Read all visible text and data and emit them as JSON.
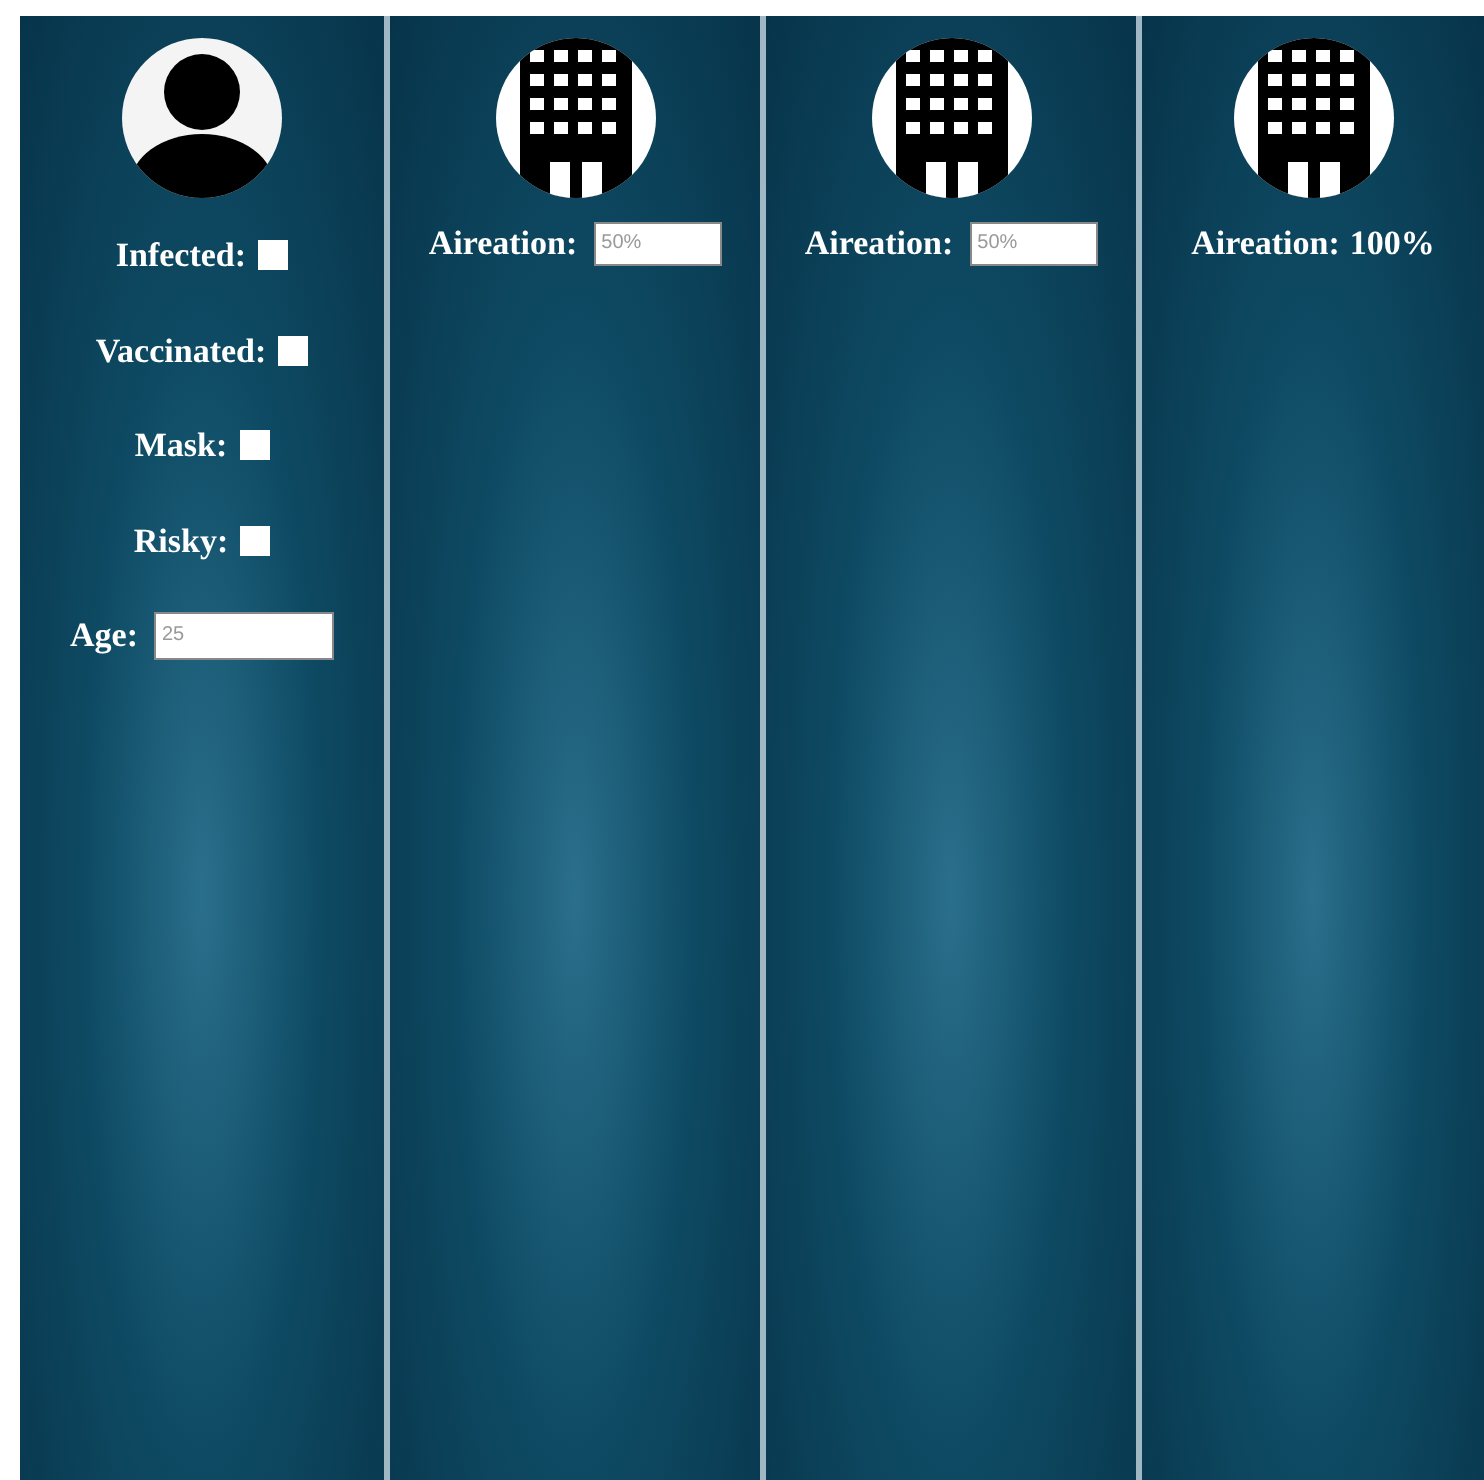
{
  "person": {
    "fields": [
      {
        "kind": "checkbox",
        "label": "Infected:",
        "checked": false
      },
      {
        "kind": "checkbox",
        "label": "Vaccinated:",
        "checked": false
      },
      {
        "kind": "checkbox",
        "label": "Mask:",
        "checked": false
      },
      {
        "kind": "checkbox",
        "label": "Risky:",
        "checked": false
      },
      {
        "kind": "input",
        "label": "Age:",
        "placeholder": "25"
      }
    ]
  },
  "rooms": [
    {
      "kind": "input",
      "label": "Aireation:",
      "placeholder": "50%"
    },
    {
      "kind": "input",
      "label": "Aireation:",
      "placeholder": "50%"
    },
    {
      "kind": "text",
      "label": "Aireation:",
      "value": "100%"
    }
  ]
}
